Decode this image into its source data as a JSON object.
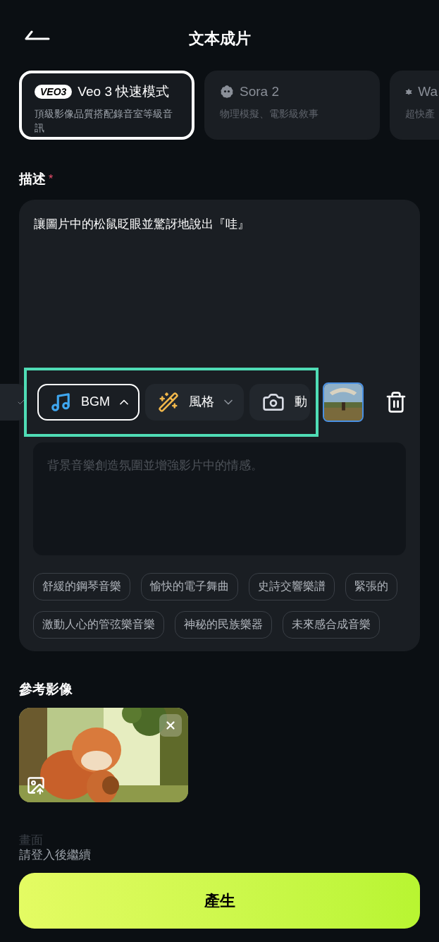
{
  "header": {
    "title": "文本成片"
  },
  "models": [
    {
      "kind": "veo",
      "badge": "VEO3",
      "name": "Veo 3 快速模式",
      "description": "頂級影像品質搭配錄音室等級音訊",
      "selected": true
    },
    {
      "kind": "sora",
      "name": "Sora 2",
      "description": "物理模擬、電影級敘事",
      "selected": false
    },
    {
      "kind": "wan",
      "name": "Wa",
      "description": "超快產",
      "selected": false
    }
  ],
  "prompt": {
    "label": "描述",
    "required": true,
    "required_mark": "*",
    "value": "讓圖片中的松鼠眨眼並驚訝地說出『哇』"
  },
  "tools": [
    {
      "kind": "note",
      "label": "BGM",
      "selected": true,
      "expanded": true
    },
    {
      "kind": "wand",
      "label": "風格",
      "selected": false,
      "expanded": false
    },
    {
      "kind": "camera",
      "label": "動",
      "selected": false
    }
  ],
  "bgm": {
    "placeholder": "背景音樂創造氛圍並增強影片中的情感。",
    "tag_rows": [
      [
        "舒緩的鋼琴音樂",
        "愉快的電子舞曲",
        "史詩交響樂譜",
        "緊張的"
      ],
      [
        "激動人心的管弦樂音樂",
        "神秘的民族樂器",
        "未來感合成音樂"
      ]
    ]
  },
  "reference": {
    "label": "參考影像"
  },
  "footer": {
    "faded_label": "畫面",
    "notice": "請登入後繼續",
    "button": "產生"
  }
}
